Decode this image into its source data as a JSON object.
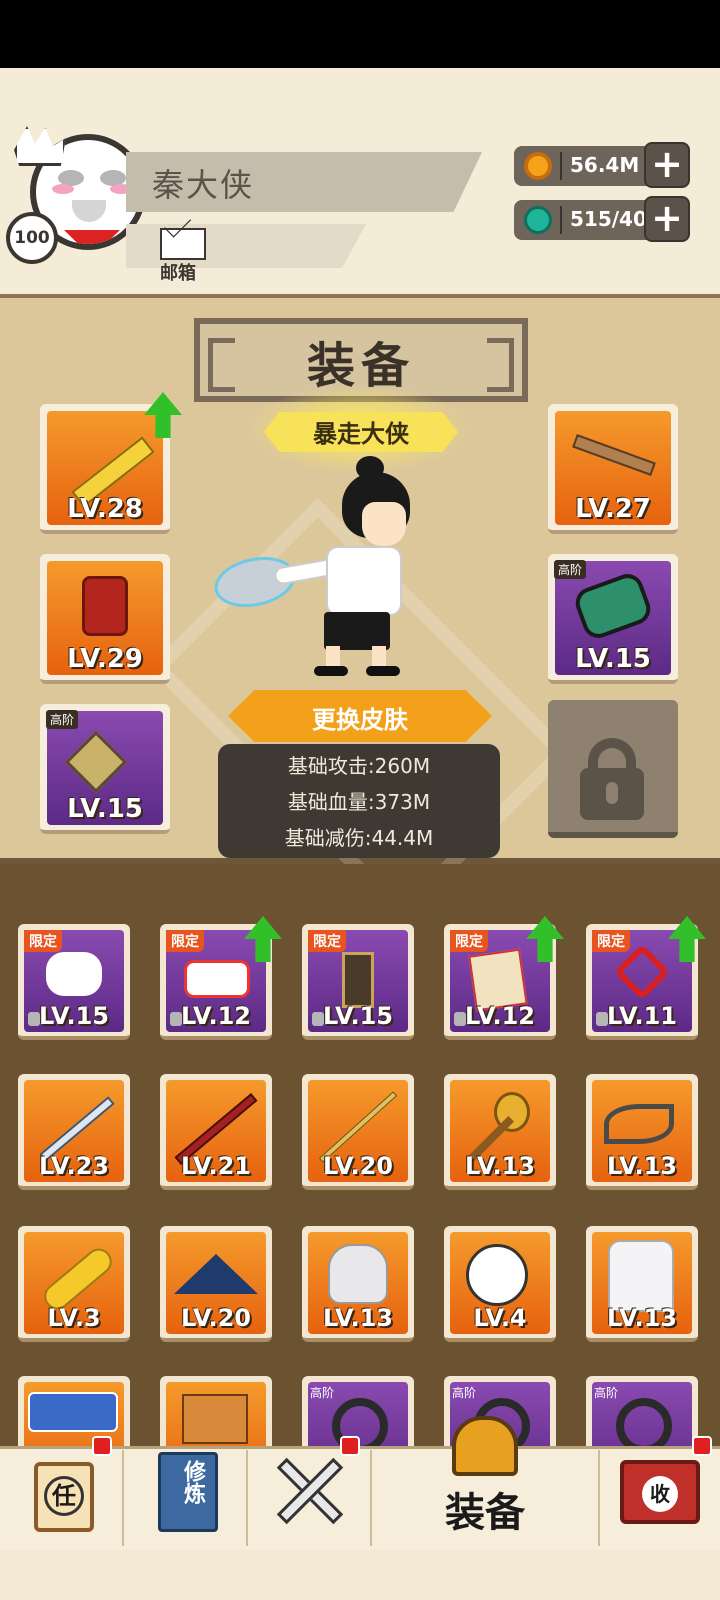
{
  "player": {
    "name": "秦大侠",
    "level": "100",
    "mail_label": "邮箱"
  },
  "currencies": [
    {
      "name": "coins",
      "value": "56.4M",
      "icon": "coin-icon",
      "color": "#f7a21b"
    },
    {
      "name": "gems",
      "value": "515/40",
      "icon": "gem-icon",
      "color": "#1fb59a"
    }
  ],
  "equip": {
    "title": "装备",
    "skin_name": "暴走大侠",
    "change_skin_label": "更换皮肤",
    "stats": [
      "基础攻击:260M",
      "基础血量:373M",
      "基础减伤:44.4M"
    ],
    "slots": [
      {
        "level": "LV.28",
        "item": "sword",
        "upgrade": true
      },
      {
        "level": "LV.29",
        "item": "armor",
        "upgrade": false
      },
      {
        "level": "LV.15",
        "item": "necklace",
        "tag": "高阶",
        "upgrade": false
      },
      {
        "level": "LV.27",
        "item": "key",
        "upgrade": false
      },
      {
        "level": "LV.15",
        "item": "bracer",
        "tag": "高阶",
        "upgrade": false
      }
    ]
  },
  "inventory": [
    {
      "level": "LV.15",
      "item": "toilet-paper",
      "tag": "限定",
      "upgrade": false
    },
    {
      "level": "LV.12",
      "item": "snack-pack",
      "tag": "限定",
      "upgrade": true
    },
    {
      "level": "LV.15",
      "item": "talisman-banner",
      "tag": "限定",
      "upgrade": false
    },
    {
      "level": "LV.12",
      "item": "book",
      "tag": "限定",
      "upgrade": true
    },
    {
      "level": "LV.11",
      "item": "chinese-knot",
      "tag": "限定",
      "upgrade": true
    },
    {
      "level": "LV.23",
      "item": "long-sword"
    },
    {
      "level": "LV.21",
      "item": "staff"
    },
    {
      "level": "LV.20",
      "item": "spear"
    },
    {
      "level": "LV.13",
      "item": "mace"
    },
    {
      "level": "LV.13",
      "item": "scissors"
    },
    {
      "level": "LV.3",
      "item": "rubber-chicken"
    },
    {
      "level": "LV.20",
      "item": "straw-hat"
    },
    {
      "level": "LV.13",
      "item": "helmet"
    },
    {
      "level": "LV.4",
      "item": "screaming-face"
    },
    {
      "level": "LV.13",
      "item": "hoodie"
    },
    {
      "level": "",
      "item": "shoulder-armor"
    },
    {
      "level": "",
      "item": "tshirt"
    },
    {
      "level": "",
      "item": "ring",
      "tag": "高阶"
    },
    {
      "level": "",
      "item": "ring",
      "tag": "高阶"
    },
    {
      "level": "",
      "item": "ring",
      "tag": "高阶"
    }
  ],
  "nav": [
    {
      "name": "task",
      "label": "任",
      "badge": true
    },
    {
      "name": "cultivate",
      "label": "修炼",
      "badge": false
    },
    {
      "name": "battle",
      "label": "",
      "badge": true
    },
    {
      "name": "equipment",
      "label": "装备",
      "badge": false
    },
    {
      "name": "collect",
      "label": "收",
      "badge": true
    }
  ]
}
